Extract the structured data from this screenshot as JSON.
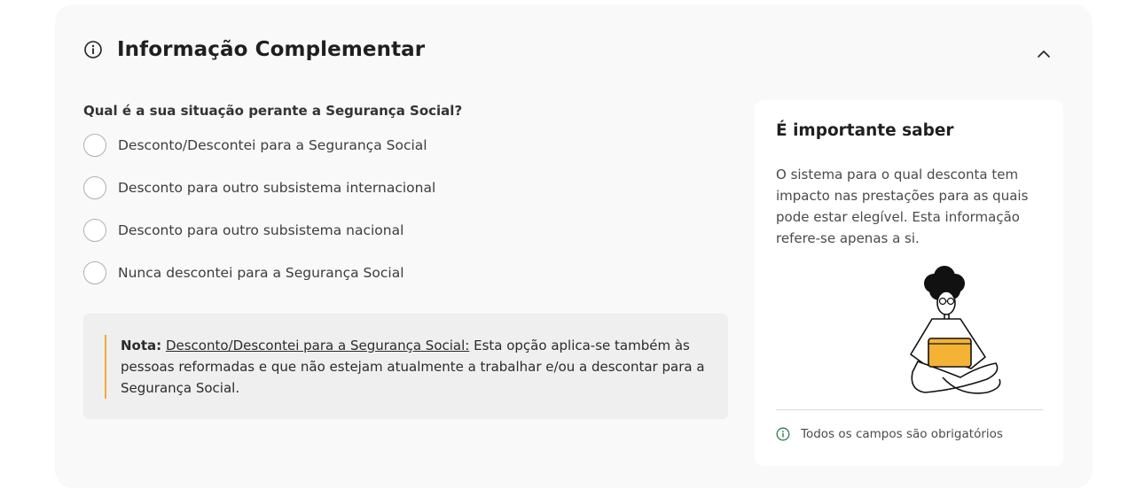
{
  "section": {
    "title": "Informação Complementar",
    "icon": "info-circle-icon",
    "collapse_icon": "chevron-up-icon"
  },
  "question": {
    "label": "Qual é a sua situação perante a Segurança Social?",
    "options": [
      "Desconto/Descontei para a Segurança Social",
      "Desconto para outro subsistema internacional",
      "Desconto para outro subsistema nacional",
      "Nunca descontei para a Segurança Social"
    ]
  },
  "note": {
    "prefix": "Nota:",
    "link": "Desconto/Descontei para a Segurança Social:",
    "text": " Esta opção aplica-se também às pessoas reformadas e que não estejam atualmente a trabalhar e/ou a descontar para a Segurança Social.",
    "accent_color": "#f2a93b"
  },
  "sidebar": {
    "title": "É importante saber",
    "text": "O sistema para o qual desconta tem impacto nas prestações para as quais pode estar elegível. Esta informação refere-se apenas a si.",
    "illustration": "person-with-laptop-illustration",
    "footer_text": "Todos os campos são obrigatórios",
    "footer_icon": "info-circle-icon",
    "footer_icon_color": "#2e7d4f"
  }
}
